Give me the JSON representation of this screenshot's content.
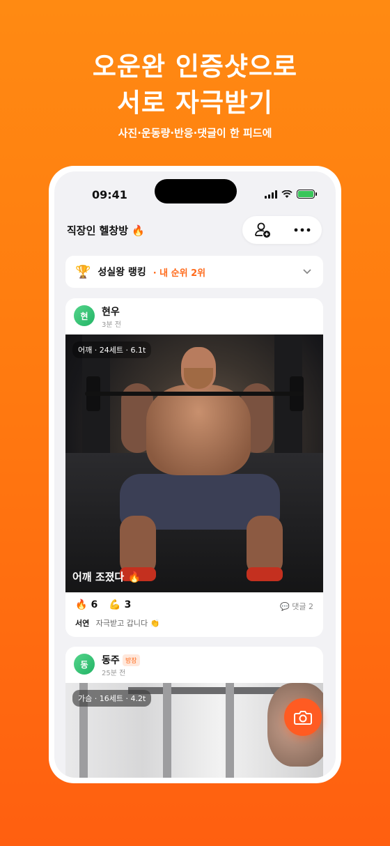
{
  "promo": {
    "headline_line1": "오운완 인증샷으로",
    "headline_line2": "서로 자극받기",
    "subline": "사진·운동량·반응·댓글이 한 피드에"
  },
  "status_bar": {
    "time": "09:41"
  },
  "room": {
    "title": "직장인 헬창방 🔥"
  },
  "ranking": {
    "icon": "🏆",
    "label": "성실왕 랭킹",
    "my_rank": "· 내 순위 2위"
  },
  "posts": [
    {
      "avatar_initial": "현",
      "author": "현우",
      "time_ago": "3분 전",
      "workout_tag": "어깨 · 24세트 · 6.1t",
      "caption": "어깨 조졌다 🔥",
      "reactions": [
        {
          "emoji": "🔥",
          "count": "6"
        },
        {
          "emoji": "💪",
          "count": "3"
        }
      ],
      "comment_count": "💬 댓글 2",
      "comment_author": "서연",
      "comment_text": "자극받고 갑니다 👏"
    },
    {
      "avatar_initial": "동",
      "author": "동주",
      "badge": "방장",
      "time_ago": "25분 전",
      "workout_tag": "가슴 · 16세트 · 4.2t"
    }
  ],
  "colors": {
    "accent": "#ff6a1a",
    "background": "#ff7a10"
  },
  "icons": {
    "add_member": "add-user-icon",
    "more": "more-icon",
    "camera": "camera-icon",
    "chevron": "chevron-down-icon"
  }
}
